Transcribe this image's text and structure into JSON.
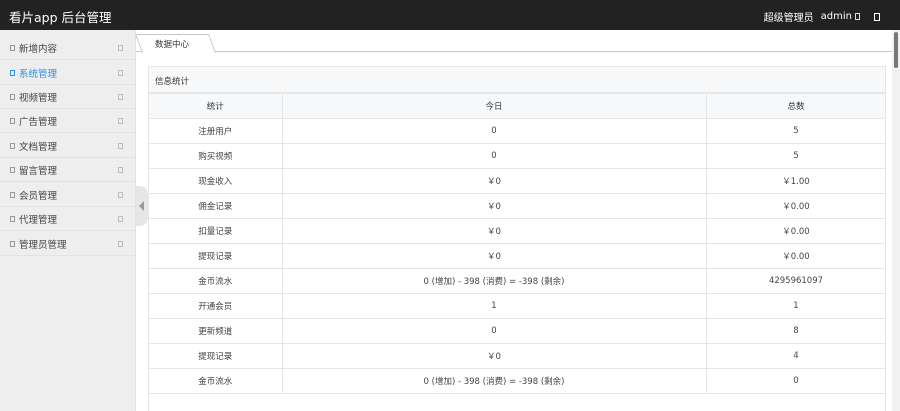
{
  "header": {
    "app_title": "看片app 后台管理",
    "role": "超级管理员",
    "username": "admin"
  },
  "sidebar": {
    "items": [
      {
        "label": "新增内容"
      },
      {
        "label": "系统管理"
      },
      {
        "label": "视频管理"
      },
      {
        "label": "广告管理"
      },
      {
        "label": "文档管理"
      },
      {
        "label": "留言管理"
      },
      {
        "label": "会员管理"
      },
      {
        "label": "代理管理"
      },
      {
        "label": "管理员管理"
      }
    ],
    "active_index": 1,
    "accent_color": "#2d8cf0"
  },
  "tabs": [
    {
      "label": "数据中心"
    }
  ],
  "panel": {
    "title": "信息统计",
    "columns": [
      "统计",
      "今日",
      "总数"
    ],
    "rows": [
      [
        "注册用户",
        "0",
        "5"
      ],
      [
        "购买视频",
        "0",
        "5"
      ],
      [
        "现金收入",
        "￥0",
        "￥1.00"
      ],
      [
        "佣金记录",
        "￥0",
        "￥0.00"
      ],
      [
        "扣量记录",
        "￥0",
        "￥0.00"
      ],
      [
        "提现记录",
        "￥0",
        "￥0.00"
      ],
      [
        "金币流水",
        "0 (增加) - 398 (消费) = -398 (剩余)",
        "4295961097"
      ],
      [
        "开通会员",
        "1",
        "1"
      ],
      [
        "更新频道",
        "0",
        "8"
      ],
      [
        "提现记录",
        "￥0",
        "4"
      ],
      [
        "金币流水",
        "0 (增加) - 398 (消费) = -398 (剩余)",
        "0"
      ]
    ]
  }
}
